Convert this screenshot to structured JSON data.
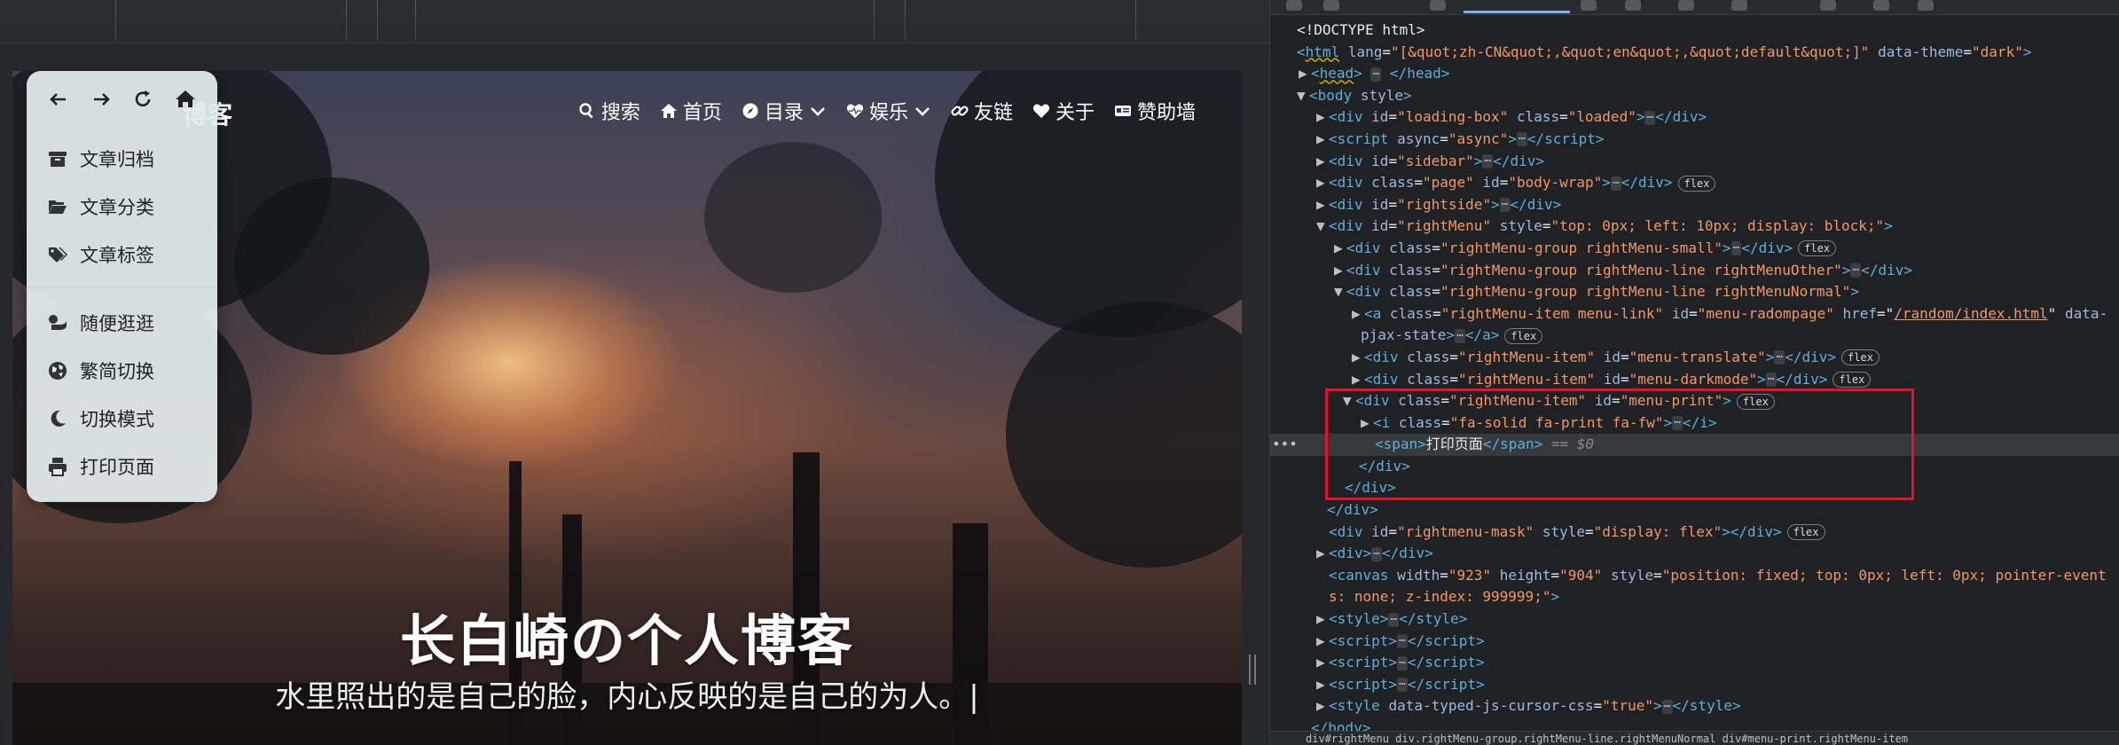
{
  "site": {
    "logo_fragment": "博客",
    "nav": [
      {
        "icon": "search-icon",
        "label": "搜索"
      },
      {
        "icon": "home-icon",
        "label": "首页"
      },
      {
        "icon": "compass-icon",
        "label": "目录",
        "dropdown": true
      },
      {
        "icon": "heartbeat-icon",
        "label": "娱乐",
        "dropdown": true
      },
      {
        "icon": "link-icon",
        "label": "友链"
      },
      {
        "icon": "heart-icon",
        "label": "关于"
      },
      {
        "icon": "card-icon",
        "label": "赞助墙"
      }
    ],
    "hero_title": "长白崎の个人博客",
    "hero_subtitle": "水里照出的是自己的脸，内心反映的是自己的为人。|"
  },
  "right_menu": {
    "small_buttons": [
      "arrow-left-icon",
      "arrow-right-icon",
      "refresh-icon",
      "home-icon"
    ],
    "group1": [
      {
        "icon": "archive-icon",
        "label": "文章归档"
      },
      {
        "icon": "folder-open-icon",
        "label": "文章分类"
      },
      {
        "icon": "tags-icon",
        "label": "文章标签"
      }
    ],
    "group2": [
      {
        "icon": "shuffle-icon",
        "label": "随便逛逛"
      },
      {
        "icon": "language-icon",
        "label": "繁简切换"
      },
      {
        "icon": "moon-icon",
        "label": "切换模式"
      },
      {
        "icon": "print-icon",
        "label": "打印页面"
      }
    ]
  },
  "devtools": {
    "lines": {
      "l1": "<!DOCTYPE html>",
      "l2_tag": "html",
      "l2_attr_lang": "lang",
      "l2_val_lang": "\"[&quot;zh-CN&quot;,&quot;en&quot;,&quot;default&quot;]\"",
      "l2_attr_theme": "data-theme",
      "l2_val_theme": "\"dark\"",
      "l3": "head",
      "l4_tag": "body",
      "l4_attr": "style",
      "l5_id": "\"loading-box\"",
      "l5_class": "\"loaded\"",
      "l6_attr": "async",
      "l6_val": "\"async\"",
      "l7_id": "\"sidebar\"",
      "l8_class": "\"page\"",
      "l8_id": "\"body-wrap\"",
      "l9_id": "\"rightside\"",
      "l10_id": "\"rightMenu\"",
      "l10_style": "\"top: 0px; left: 10px; display: block;\"",
      "l11_class": "\"rightMenu-group rightMenu-small\"",
      "l12_class": "\"rightMenu-group rightMenu-line rightMenuOther\"",
      "l13_class": "\"rightMenu-group rightMenu-line rightMenuNormal\"",
      "l14_class": "\"rightMenu-item menu-link\"",
      "l14_id": "\"menu-radompage\"",
      "l14_href": "/random/index.html",
      "l14_tail": "data-",
      "l15": "pjax-state",
      "l16_class": "\"rightMenu-item\"",
      "l16_id": "\"menu-translate\"",
      "l17_class": "\"rightMenu-item\"",
      "l17_id": "\"menu-darkmode\"",
      "l18_class": "\"rightMenu-item\"",
      "l18_id": "\"menu-print\"",
      "l19_class": "\"fa-solid fa-print fa-fw\"",
      "l20_text": "打印页面",
      "l20_note": "== $0",
      "l24_id": "\"rightmenu-mask\"",
      "l24_style": "\"display: flex\"",
      "l26_width": "\"923\"",
      "l26_height": "\"904\"",
      "l26_style": "\"position: fixed; top: 0px; left: 0px; pointer-event",
      "l27": "s: none; z-index: 999999;\"",
      "l32_attr": "data-typed-js-cursor-css",
      "l32_val": "\"true\"",
      "flex_badge": "flex"
    },
    "breadcrumb": "div#rightMenu  div.rightMenu-group.rightMenu-line.rightMenuNormal  div#menu-print.rightMenu-item"
  },
  "colors": {
    "highlight_box": "#e8102a",
    "devtools_bg": "#202124",
    "menu_bg": "#e2ecec"
  }
}
